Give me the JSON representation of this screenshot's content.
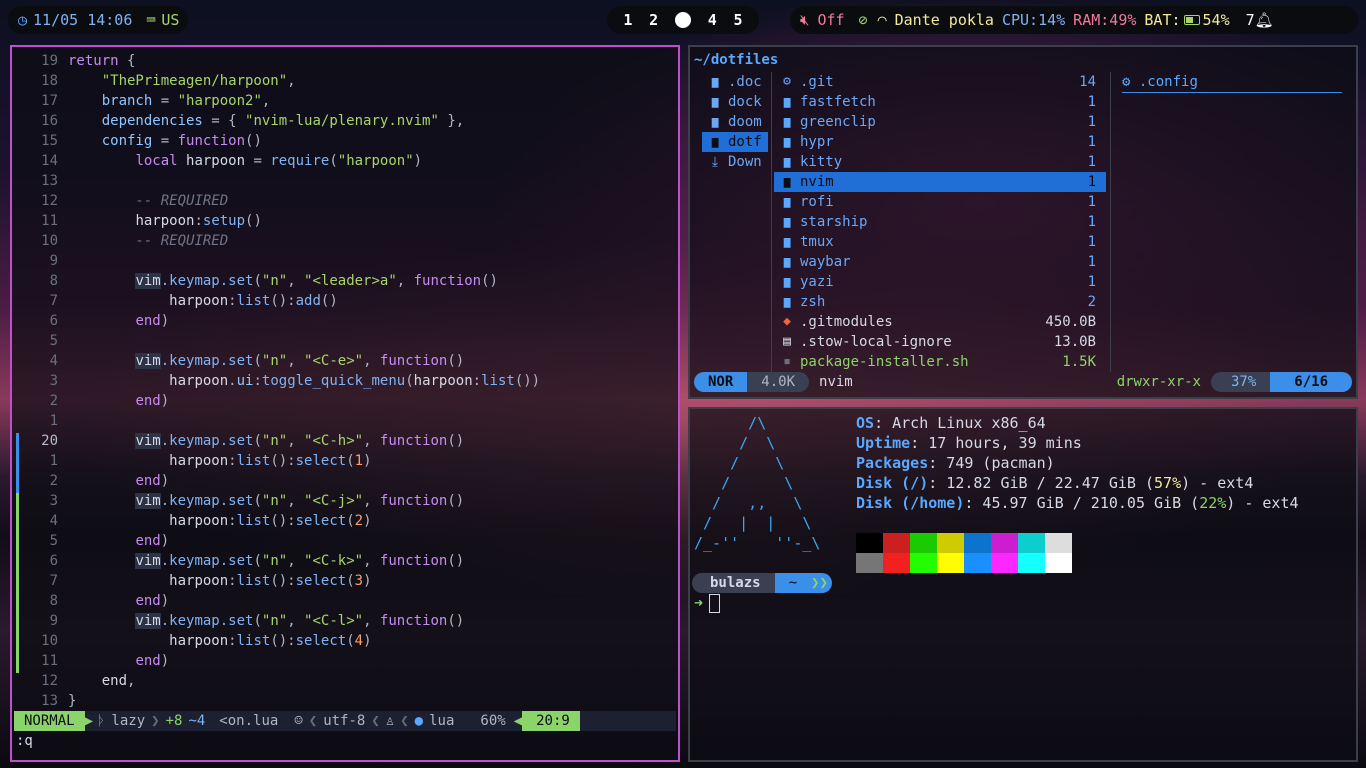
{
  "topbar": {
    "clock": "11/05 14:06",
    "keyboard_layout": "US",
    "workspaces": [
      "1",
      "2",
      "",
      "4",
      "5"
    ],
    "active_workspace_index": 2,
    "volume": "Off",
    "network_name": "Dante pokla",
    "cpu": "CPU:14%",
    "ram": "RAM:49%",
    "battery": "BAT:",
    "battery_pct": "54%",
    "notifications": "7",
    "colors": {
      "cpu": "#7fb3f5",
      "ram": "#f07a9a",
      "bat": "#f3e89a",
      "net": "#f3e89a",
      "vol": "#f07a9a"
    }
  },
  "editor": {
    "lines": [
      {
        "n": "19",
        "code": [
          [
            "kw",
            "return "
          ],
          [
            "pun",
            "{"
          ]
        ]
      },
      {
        "n": "18",
        "code": [
          [
            "",
            "    "
          ],
          [
            "str",
            "\"ThePrimeagen/harpoon\""
          ],
          [
            "pun",
            ","
          ]
        ]
      },
      {
        "n": "17",
        "code": [
          [
            "",
            "    "
          ],
          [
            "var",
            "branch"
          ],
          [
            "pun",
            " = "
          ],
          [
            "str",
            "\"harpoon2\""
          ],
          [
            "pun",
            ","
          ]
        ]
      },
      {
        "n": "16",
        "code": [
          [
            "",
            "    "
          ],
          [
            "var",
            "dependencies"
          ],
          [
            "pun",
            " = { "
          ],
          [
            "str",
            "\"nvim-lua/plenary.nvim\""
          ],
          [
            "pun",
            " },"
          ]
        ]
      },
      {
        "n": "15",
        "code": [
          [
            "",
            "    "
          ],
          [
            "var",
            "config"
          ],
          [
            "pun",
            " = "
          ],
          [
            "kw",
            "function"
          ],
          [
            "pun",
            "()"
          ]
        ]
      },
      {
        "n": "14",
        "code": [
          [
            "",
            "        "
          ],
          [
            "kw",
            "local "
          ],
          [
            "",
            "harpoon "
          ],
          [
            "pun",
            "= "
          ],
          [
            "fn",
            "require"
          ],
          [
            "pun",
            "("
          ],
          [
            "str",
            "\"harpoon\""
          ],
          [
            "pun",
            ")"
          ]
        ]
      },
      {
        "n": "13",
        "code": []
      },
      {
        "n": "12",
        "code": [
          [
            "",
            "        "
          ],
          [
            "cm",
            "-- REQUIRED"
          ]
        ]
      },
      {
        "n": "11",
        "code": [
          [
            "",
            "        "
          ],
          [
            "",
            "harpoon"
          ],
          [
            "pun",
            ":"
          ],
          [
            "fn",
            "setup"
          ],
          [
            "pun",
            "()"
          ]
        ]
      },
      {
        "n": "10",
        "code": [
          [
            "",
            "        "
          ],
          [
            "cm",
            "-- REQUIRED"
          ]
        ]
      },
      {
        "n": "9",
        "code": []
      },
      {
        "n": "8",
        "code": [
          [
            "",
            "        "
          ],
          [
            "vimhl",
            "vim"
          ],
          [
            "fn",
            ".keymap.set"
          ],
          [
            "pun",
            "("
          ],
          [
            "str",
            "\"n\""
          ],
          [
            "pun",
            ", "
          ],
          [
            "str",
            "\"<leader>a\""
          ],
          [
            "pun",
            ", "
          ],
          [
            "kw",
            "function"
          ],
          [
            "pun",
            "()"
          ]
        ]
      },
      {
        "n": "7",
        "code": [
          [
            "",
            "            "
          ],
          [
            "",
            "harpoon"
          ],
          [
            "pun",
            ":"
          ],
          [
            "fn",
            "list"
          ],
          [
            "pun",
            "():"
          ],
          [
            "fn",
            "add"
          ],
          [
            "pun",
            "()"
          ]
        ]
      },
      {
        "n": "6",
        "code": [
          [
            "",
            "        "
          ],
          [
            "kw",
            "end"
          ],
          [
            "pun",
            ")"
          ]
        ]
      },
      {
        "n": "5",
        "code": []
      },
      {
        "n": "4",
        "code": [
          [
            "",
            "        "
          ],
          [
            "vimhl",
            "vim"
          ],
          [
            "fn",
            ".keymap.set"
          ],
          [
            "pun",
            "("
          ],
          [
            "str",
            "\"n\""
          ],
          [
            "pun",
            ", "
          ],
          [
            "str",
            "\"<C-e>\""
          ],
          [
            "pun",
            ", "
          ],
          [
            "kw",
            "function"
          ],
          [
            "pun",
            "()"
          ]
        ]
      },
      {
        "n": "3",
        "code": [
          [
            "",
            "            "
          ],
          [
            "",
            "harpoon"
          ],
          [
            "pun",
            "."
          ],
          [
            "var",
            "ui"
          ],
          [
            "pun",
            ":"
          ],
          [
            "fn",
            "toggle_quick_menu"
          ],
          [
            "pun",
            "("
          ],
          [
            "",
            "harpoon"
          ],
          [
            "pun",
            ":"
          ],
          [
            "fn",
            "list"
          ],
          [
            "pun",
            "())"
          ]
        ]
      },
      {
        "n": "2",
        "code": [
          [
            "",
            "        "
          ],
          [
            "kw",
            "end"
          ],
          [
            "pun",
            ")"
          ]
        ]
      },
      {
        "n": "1",
        "code": []
      },
      {
        "n": "20",
        "cur": true,
        "code": [
          [
            "",
            "        "
          ],
          [
            "vimhl",
            "vim"
          ],
          [
            "fn",
            ".keymap.set"
          ],
          [
            "pun",
            "("
          ],
          [
            "str",
            "\"n\""
          ],
          [
            "pun",
            ", "
          ],
          [
            "str",
            "\"<C-h>\""
          ],
          [
            "pun",
            ", "
          ],
          [
            "kw",
            "function"
          ],
          [
            "pun",
            "()"
          ]
        ]
      },
      {
        "n": "1",
        "code": [
          [
            "",
            "            "
          ],
          [
            "",
            "harpoon"
          ],
          [
            "pun",
            ":"
          ],
          [
            "fn",
            "list"
          ],
          [
            "pun",
            "():"
          ],
          [
            "fn",
            "select"
          ],
          [
            "pun",
            "("
          ],
          [
            "num",
            "1"
          ],
          [
            "pun",
            ")"
          ]
        ]
      },
      {
        "n": "2",
        "code": [
          [
            "",
            "        "
          ],
          [
            "kw",
            "end"
          ],
          [
            "pun",
            ")"
          ]
        ]
      },
      {
        "n": "3",
        "code": [
          [
            "",
            "        "
          ],
          [
            "vimhl",
            "vim"
          ],
          [
            "fn",
            ".keymap.set"
          ],
          [
            "pun",
            "("
          ],
          [
            "str",
            "\"n\""
          ],
          [
            "pun",
            ", "
          ],
          [
            "str",
            "\"<C-j>\""
          ],
          [
            "pun",
            ", "
          ],
          [
            "kw",
            "function"
          ],
          [
            "pun",
            "()"
          ]
        ]
      },
      {
        "n": "4",
        "code": [
          [
            "",
            "            "
          ],
          [
            "",
            "harpoon"
          ],
          [
            "pun",
            ":"
          ],
          [
            "fn",
            "list"
          ],
          [
            "pun",
            "():"
          ],
          [
            "fn",
            "select"
          ],
          [
            "pun",
            "("
          ],
          [
            "num",
            "2"
          ],
          [
            "pun",
            ")"
          ]
        ]
      },
      {
        "n": "5",
        "code": [
          [
            "",
            "        "
          ],
          [
            "kw",
            "end"
          ],
          [
            "pun",
            ")"
          ]
        ]
      },
      {
        "n": "6",
        "code": [
          [
            "",
            "        "
          ],
          [
            "vimhl",
            "vim"
          ],
          [
            "fn",
            ".keymap.set"
          ],
          [
            "pun",
            "("
          ],
          [
            "str",
            "\"n\""
          ],
          [
            "pun",
            ", "
          ],
          [
            "str",
            "\"<C-k>\""
          ],
          [
            "pun",
            ", "
          ],
          [
            "kw",
            "function"
          ],
          [
            "pun",
            "()"
          ]
        ]
      },
      {
        "n": "7",
        "code": [
          [
            "",
            "            "
          ],
          [
            "",
            "harpoon"
          ],
          [
            "pun",
            ":"
          ],
          [
            "fn",
            "list"
          ],
          [
            "pun",
            "():"
          ],
          [
            "fn",
            "select"
          ],
          [
            "pun",
            "("
          ],
          [
            "num",
            "3"
          ],
          [
            "pun",
            ")"
          ]
        ]
      },
      {
        "n": "8",
        "code": [
          [
            "",
            "        "
          ],
          [
            "kw",
            "end"
          ],
          [
            "pun",
            ")"
          ]
        ]
      },
      {
        "n": "9",
        "code": [
          [
            "",
            "        "
          ],
          [
            "vimhl",
            "vim"
          ],
          [
            "fn",
            ".keymap.set"
          ],
          [
            "pun",
            "("
          ],
          [
            "str",
            "\"n\""
          ],
          [
            "pun",
            ", "
          ],
          [
            "str",
            "\"<C-l>\""
          ],
          [
            "pun",
            ", "
          ],
          [
            "kw",
            "function"
          ],
          [
            "pun",
            "()"
          ]
        ]
      },
      {
        "n": "10",
        "code": [
          [
            "",
            "            "
          ],
          [
            "",
            "harpoon"
          ],
          [
            "pun",
            ":"
          ],
          [
            "fn",
            "list"
          ],
          [
            "pun",
            "():"
          ],
          [
            "fn",
            "select"
          ],
          [
            "pun",
            "("
          ],
          [
            "num",
            "4"
          ],
          [
            "pun",
            ")"
          ]
        ]
      },
      {
        "n": "11",
        "code": [
          [
            "",
            "        "
          ],
          [
            "kw",
            "end"
          ],
          [
            "pun",
            ")"
          ]
        ]
      },
      {
        "n": "12",
        "code": [
          [
            "",
            "    "
          ],
          [
            "",
            "end"
          ],
          [
            "pun",
            ","
          ]
        ]
      },
      {
        "n": "13",
        "code": [
          [
            "pun",
            "}"
          ]
        ]
      }
    ],
    "statusline": {
      "mode": "NORMAL",
      "plugin": "lazy",
      "added": "+8",
      "changed": "~4",
      "filename": "<on.lua",
      "encoding": "utf-8",
      "filetype": "lua",
      "percent": "60%",
      "position": "20:9"
    },
    "cmdline": ":q"
  },
  "filemanager": {
    "path": "~/dotfiles",
    "parent": [
      ".doc",
      "dock",
      "doom",
      "dotf",
      "Down"
    ],
    "parent_selected": 3,
    "entries": [
      {
        "name": ".git",
        "size": "14",
        "type": "gitdir"
      },
      {
        "name": "fastfetch",
        "size": "1",
        "type": "dir"
      },
      {
        "name": "greenclip",
        "size": "1",
        "type": "dir"
      },
      {
        "name": "hypr",
        "size": "1",
        "type": "dir"
      },
      {
        "name": "kitty",
        "size": "1",
        "type": "dir"
      },
      {
        "name": "nvim",
        "size": "1",
        "type": "dir",
        "selected": true
      },
      {
        "name": "rofi",
        "size": "1",
        "type": "dir"
      },
      {
        "name": "starship",
        "size": "1",
        "type": "dir"
      },
      {
        "name": "tmux",
        "size": "1",
        "type": "dir"
      },
      {
        "name": "waybar",
        "size": "1",
        "type": "dir"
      },
      {
        "name": "yazi",
        "size": "1",
        "type": "dir"
      },
      {
        "name": "zsh",
        "size": "2",
        "type": "dir"
      },
      {
        "name": ".gitmodules",
        "size": "450.0B",
        "type": "gitfile"
      },
      {
        "name": ".stow-local-ignore",
        "size": "13.0B",
        "type": "file"
      },
      {
        "name": "package-installer.sh",
        "size": "1.5K",
        "type": "exec"
      }
    ],
    "preview": ".config",
    "status": {
      "mode": "NOR",
      "size": "4.0K",
      "name": "nvim",
      "perms": "drwxr-xr-x",
      "percent": "37%",
      "count": "6/16"
    }
  },
  "terminal": {
    "ascii_logo": "      /\\\n     /  \\\n    /    \\\n   /      \\\n  /   ,,   \\\n /   |  |   \\\n/_-''    ''-_\\",
    "info": [
      {
        "k": "OS",
        "v": ": Arch Linux x86_64"
      },
      {
        "k": "Uptime",
        "v": ": 17 hours, 39 mins"
      },
      {
        "k": "Packages",
        "v": ": 749 (pacman)"
      },
      {
        "k": "Disk (/)",
        "v": ": 12.82 GiB / 22.47 GiB (",
        "pct": "57%",
        "tail": ") - ext4"
      },
      {
        "k": "Disk (/home)",
        "v": ": 45.97 GiB / 210.05 GiB (",
        "pct": "22%",
        "tail": ") - ext4"
      }
    ],
    "palette_top": [
      "#000000",
      "#cc1f1f",
      "#19cb00",
      "#cecb00",
      "#0d73cc",
      "#cb1ed1",
      "#0dcdcd",
      "#dddddd"
    ],
    "palette_bottom": [
      "#767676",
      "#f2201f",
      "#23fd00",
      "#fffd00",
      "#1a8fff",
      "#fd28ff",
      "#14ffff",
      "#ffffff"
    ],
    "prompt_user": "bulazs",
    "prompt_dir": "~",
    "prompt_arrow": "➜"
  }
}
